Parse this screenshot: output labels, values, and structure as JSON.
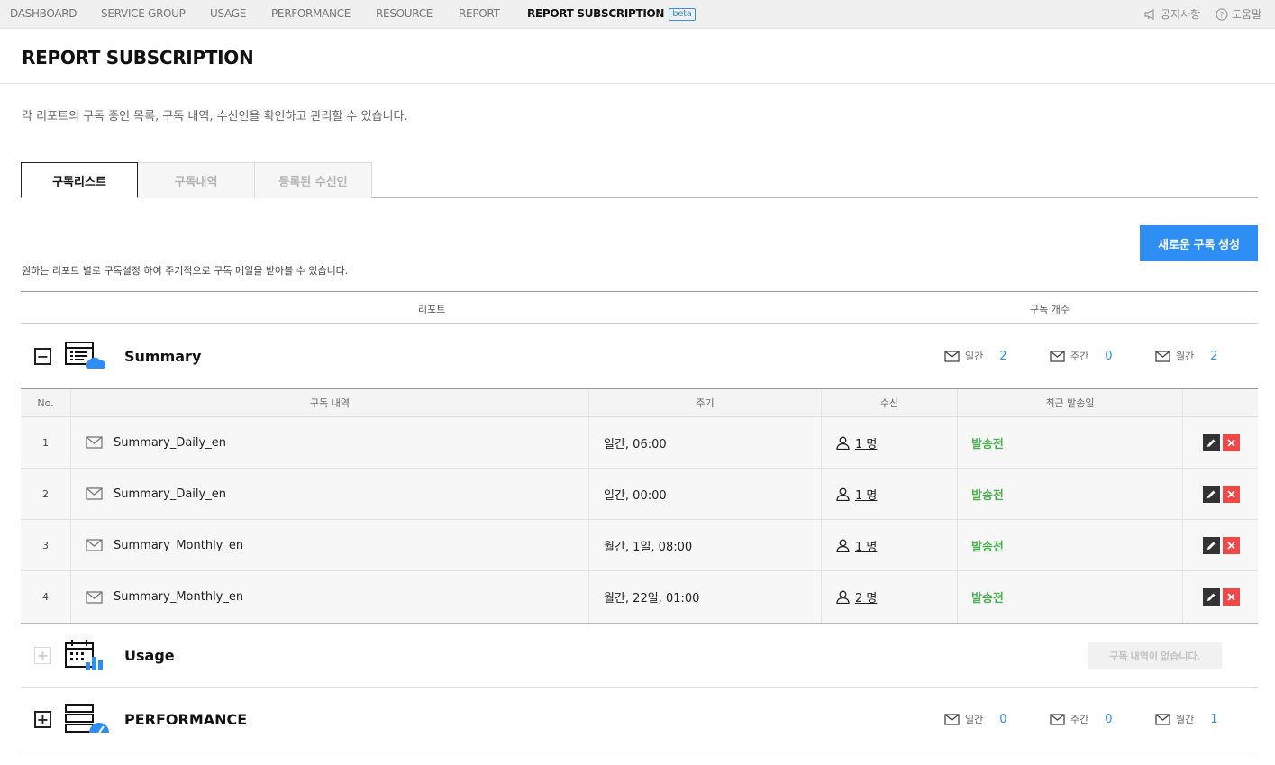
{
  "nav": {
    "items": [
      "DASHBOARD",
      "SERVICE GROUP",
      "USAGE",
      "PERFORMANCE",
      "RESOURCE",
      "REPORT",
      "REPORT SUBSCRIPTION"
    ],
    "beta_badge": "beta",
    "notice_label": "공지사항",
    "help_label": "도움말"
  },
  "page": {
    "title": "REPORT SUBSCRIPTION",
    "description": "각 리포트의 구독 중인 목록, 구독 내역, 수신인을 확인하고 관리할 수 있습니다."
  },
  "tabs": [
    {
      "label": "구독리스트",
      "active": true
    },
    {
      "label": "구독내역",
      "active": false
    },
    {
      "label": "등록된 수신인",
      "active": false
    }
  ],
  "new_subscription_button": "새로운 구독 생성",
  "subdescription": "원하는 리포트 별로 구독설정 하여 주기적으로 구독 메일을 받아볼 수 있습니다.",
  "list_header": {
    "report": "리포트",
    "count": "구독 개수"
  },
  "groups": {
    "summary": {
      "name": "Summary",
      "toggle": "−",
      "counts": [
        {
          "label": "일간",
          "value": "2"
        },
        {
          "label": "주간",
          "value": "0"
        },
        {
          "label": "월간",
          "value": "2"
        }
      ]
    },
    "usage": {
      "name": "Usage",
      "toggle": "+",
      "empty_label": "구독 내역이 없습니다."
    },
    "performance": {
      "name": "PERFORMANCE",
      "toggle": "+",
      "counts": [
        {
          "label": "일간",
          "value": "0"
        },
        {
          "label": "주간",
          "value": "0"
        },
        {
          "label": "월간",
          "value": "1"
        }
      ]
    }
  },
  "detail_table": {
    "headers": {
      "no": "No.",
      "name": "구독 내역",
      "period": "주기",
      "recipients": "수신",
      "last_sent": "최근 발송일"
    },
    "rows": [
      {
        "no": "1",
        "name": "Summary_Daily_en",
        "period": "일간, 06:00",
        "recipients": "1 명",
        "last_sent": "발송전"
      },
      {
        "no": "2",
        "name": "Summary_Daily_en",
        "period": "일간, 00:00",
        "recipients": "1 명",
        "last_sent": "발송전"
      },
      {
        "no": "3",
        "name": "Summary_Monthly_en",
        "period": "월간, 1일, 08:00",
        "recipients": "1 명",
        "last_sent": "발송전"
      },
      {
        "no": "4",
        "name": "Summary_Monthly_en",
        "period": "월간, 22일, 01:00",
        "recipients": "2 명",
        "last_sent": "발송전"
      }
    ]
  },
  "colors": {
    "accent": "#2f8ef3",
    "status_pending": "#4caf50",
    "delete": "#f04747"
  }
}
